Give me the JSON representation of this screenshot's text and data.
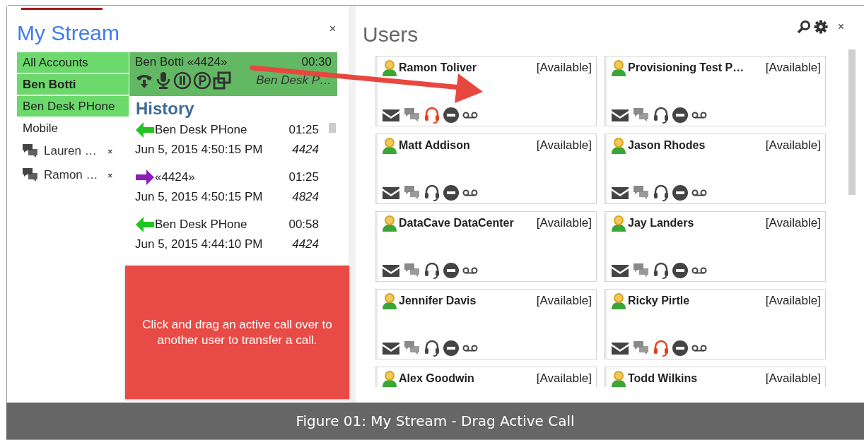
{
  "my_stream": {
    "title": "My Stream",
    "close": "×",
    "accounts": [
      {
        "label": "All Accounts",
        "kind": "group",
        "selected": true
      },
      {
        "label": "Ben Botti",
        "kind": "user",
        "selected": true
      },
      {
        "label": "Ben Desk PHone",
        "kind": "device",
        "selected": true
      },
      {
        "label": "Mobile",
        "kind": "device",
        "selected": false
      }
    ],
    "chats": [
      {
        "name": "Lauren …",
        "close": "×"
      },
      {
        "name": "Ramon …",
        "close": "×"
      }
    ],
    "active_call": {
      "caller": "Ben Botti «4424»",
      "duration": "00:30",
      "device": "Ben Desk P…"
    },
    "history": {
      "title": "History",
      "entries": [
        {
          "kind": "incoming",
          "name": "Ben Desk PHone",
          "duration": "01:25",
          "time": "Jun 5, 2015 4:50:15 PM",
          "extension": "4424"
        },
        {
          "kind": "outgoing",
          "name": "«4424»",
          "duration": "01:25",
          "time": "Jun 5, 2015 4:50:15 PM",
          "extension": "4824"
        },
        {
          "kind": "incoming",
          "name": "Ben Desk PHone",
          "duration": "00:58",
          "time": "Jun 5, 2015 4:44:10 PM",
          "extension": "4424"
        }
      ]
    }
  },
  "users": {
    "title": "Users",
    "close": "×",
    "list": [
      {
        "name": "Ramon Toliver",
        "status": "[Available]",
        "on_call": true
      },
      {
        "name": "Provisioning Test P…",
        "status": "[Available]",
        "on_call": false
      },
      {
        "name": "Matt Addison",
        "status": "[Available]",
        "on_call": false
      },
      {
        "name": "Jason Rhodes",
        "status": "[Available]",
        "on_call": false
      },
      {
        "name": "DataCave DataCenter",
        "status": "[Available]",
        "on_call": false
      },
      {
        "name": "Jay Landers",
        "status": "[Available]",
        "on_call": false
      },
      {
        "name": "Jennifer Davis",
        "status": "[Available]",
        "on_call": false
      },
      {
        "name": "Ricky Pirtle",
        "status": "[Available]",
        "on_call": true
      },
      {
        "name": "Alex Goodwin",
        "status": "[Available]"
      },
      {
        "name": "Todd Wilkins",
        "status": "[Available]"
      }
    ]
  },
  "callout": "Click and drag an active call over to another user to transfer a call.",
  "caption": "Figure 01: My Stream - Drag Active Call"
}
